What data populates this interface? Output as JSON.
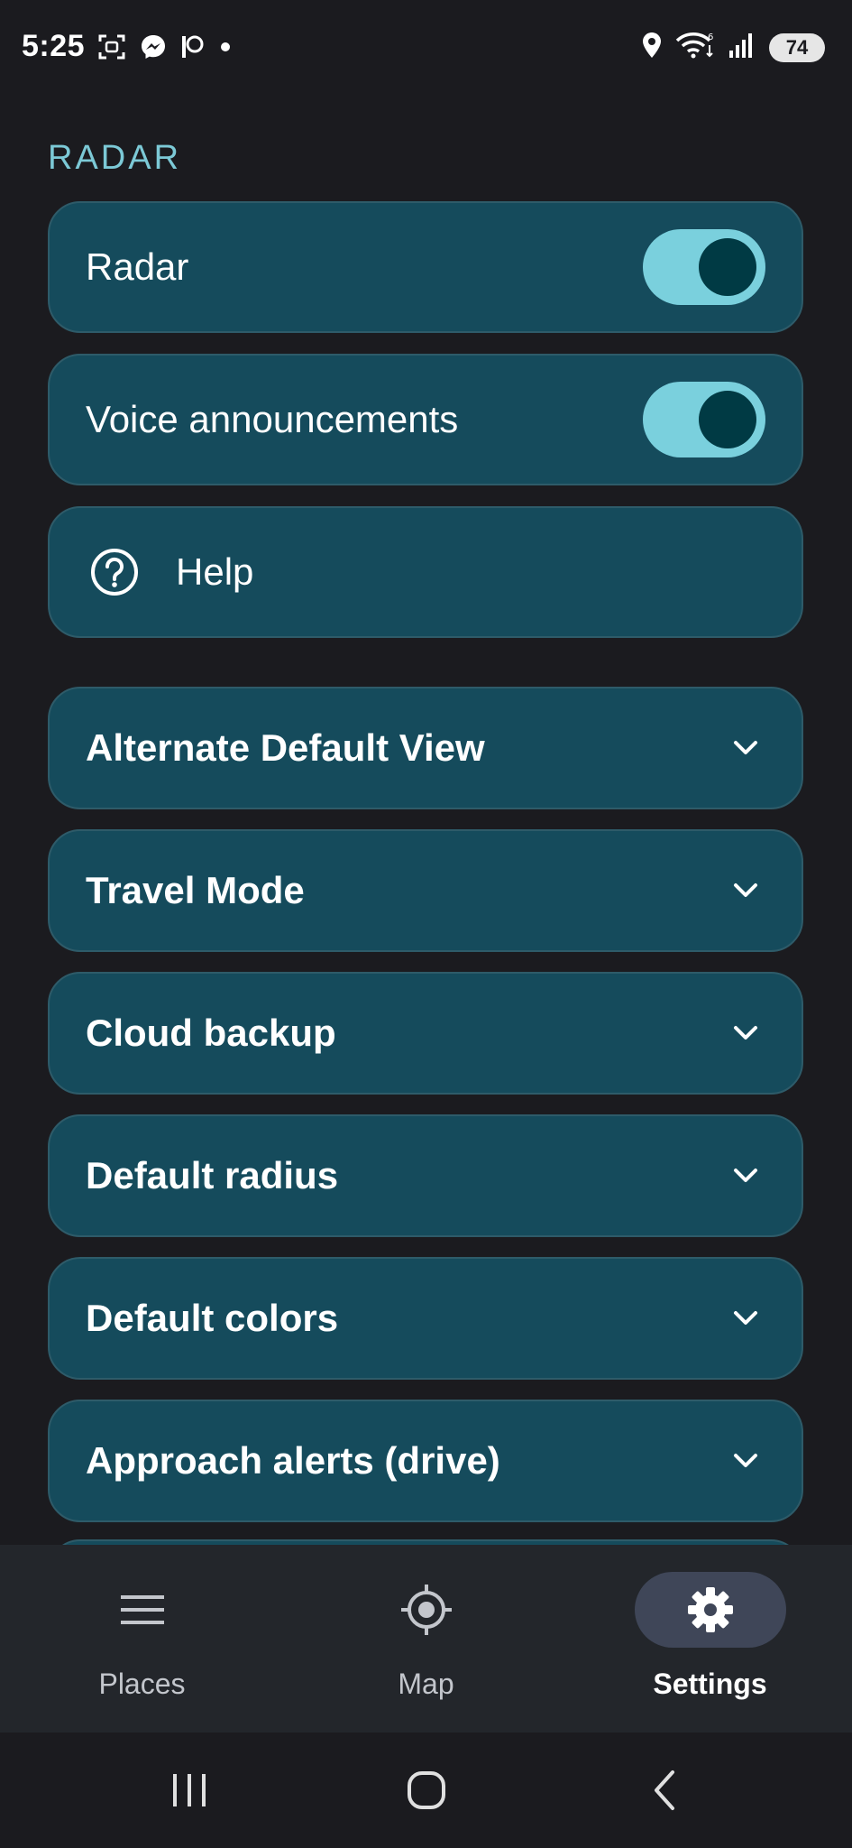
{
  "status_bar": {
    "time": "5:25",
    "battery": "74",
    "left_icons": [
      "screenshot-icon",
      "messenger-icon",
      "patreon-icon",
      "dot-icon"
    ],
    "right_icons": [
      "location-icon",
      "wifi-icon",
      "signal-icon",
      "battery-icon"
    ]
  },
  "section": {
    "title": "RADAR"
  },
  "toggles": [
    {
      "label": "Radar",
      "on": true
    },
    {
      "label": "Voice announcements",
      "on": true
    }
  ],
  "help": {
    "label": "Help",
    "icon": "help-circle-icon"
  },
  "expandables": [
    {
      "label": "Alternate Default View"
    },
    {
      "label": "Travel Mode"
    },
    {
      "label": "Cloud backup"
    },
    {
      "label": "Default radius"
    },
    {
      "label": "Default colors"
    },
    {
      "label": "Approach alerts (drive)"
    }
  ],
  "bottom_nav": {
    "items": [
      {
        "label": "Places",
        "icon": "menu-icon",
        "active": false
      },
      {
        "label": "Map",
        "icon": "gps-crosshair-icon",
        "active": false
      },
      {
        "label": "Settings",
        "icon": "gear-icon",
        "active": true
      }
    ]
  },
  "colors": {
    "background": "#1b1b1f",
    "card": "#154b5c",
    "accent": "#7ad0dd",
    "section_title": "#7cc9d6",
    "nav_background": "#23262b",
    "nav_active_pill": "#3f4658"
  }
}
